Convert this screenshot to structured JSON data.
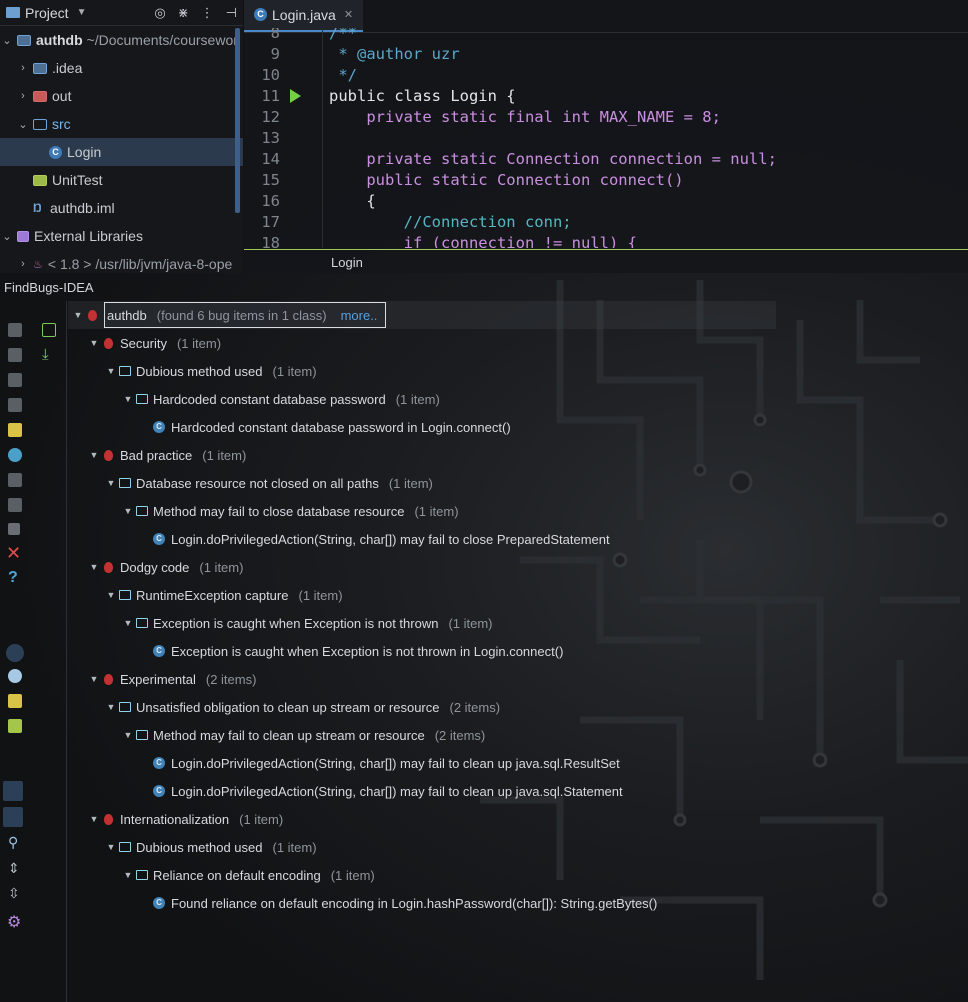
{
  "project": {
    "title": "Project",
    "header_icons": [
      "target-icon",
      "collapse-icon",
      "more-icon",
      "hide-icon"
    ],
    "tree": [
      {
        "label": "authdb",
        "extra": "~/Documents/coursewor",
        "level": 0,
        "icon": "folder"
      },
      {
        "label": ".idea",
        "level": 1,
        "icon": "folder"
      },
      {
        "label": "out",
        "level": 1,
        "icon": "folder-red"
      },
      {
        "label": "src",
        "level": 1,
        "icon": "folder-src"
      },
      {
        "label": "Login",
        "level": 2,
        "icon": "class"
      },
      {
        "label": "UnitTest",
        "level": 1,
        "icon": "folder-green"
      },
      {
        "label": "authdb.iml",
        "level": 1,
        "icon": "iml"
      },
      {
        "label": "External Libraries",
        "level": 0,
        "icon": "library"
      },
      {
        "label": "< 1.8 > /usr/lib/jvm/java-8-ope",
        "level": 1,
        "icon": "jdk"
      }
    ]
  },
  "editor": {
    "tab_label": "Login.java",
    "footer": "Login",
    "lines": [
      {
        "n": "8",
        "text": "/**"
      },
      {
        "n": "9",
        "text": " * @author uzr"
      },
      {
        "n": "10",
        "text": " */"
      },
      {
        "n": "11",
        "text": "public class Login {"
      },
      {
        "n": "12",
        "text": "    private static final int MAX_NAME = 8;"
      },
      {
        "n": "13",
        "text": ""
      },
      {
        "n": "14",
        "text": "    private static Connection connection = null;"
      },
      {
        "n": "15",
        "text": "    public static Connection connect()"
      },
      {
        "n": "16",
        "text": "    {"
      },
      {
        "n": "17",
        "text": "        //Connection conn;"
      },
      {
        "n": "18",
        "text": "        if (connection != null) {"
      }
    ]
  },
  "findbugs": {
    "title": "FindBugs-IDEA",
    "root": {
      "label": "authdb",
      "count": "(found 6 bug items in 1 class)",
      "more": "more.."
    },
    "rows": [
      {
        "level": 1,
        "type": "bug",
        "label": "Security",
        "count": "(1 item)"
      },
      {
        "level": 2,
        "type": "folder",
        "label": "Dubious method used",
        "count": "(1 item)"
      },
      {
        "level": 3,
        "type": "folder",
        "label": "Hardcoded constant database password",
        "count": "(1 item)"
      },
      {
        "level": 4,
        "type": "class",
        "label": "Hardcoded constant database password in Login.connect()",
        "count": ""
      },
      {
        "level": 1,
        "type": "bug",
        "label": "Bad practice",
        "count": "(1 item)"
      },
      {
        "level": 2,
        "type": "folder",
        "label": "Database resource not closed on all paths",
        "count": "(1 item)"
      },
      {
        "level": 3,
        "type": "folder",
        "label": "Method may fail to close database resource",
        "count": "(1 item)"
      },
      {
        "level": 4,
        "type": "class",
        "label": "Login.doPrivilegedAction(String, char[]) may fail to close PreparedStatement",
        "count": ""
      },
      {
        "level": 1,
        "type": "bug",
        "label": "Dodgy code",
        "count": "(1 item)"
      },
      {
        "level": 2,
        "type": "folder",
        "label": "RuntimeException capture",
        "count": "(1 item)"
      },
      {
        "level": 3,
        "type": "folder",
        "label": "Exception is caught when Exception is not thrown",
        "count": "(1 item)"
      },
      {
        "level": 4,
        "type": "class",
        "label": "Exception is caught when Exception is not thrown in Login.connect()",
        "count": ""
      },
      {
        "level": 1,
        "type": "bug",
        "label": "Experimental",
        "count": "(2 items)"
      },
      {
        "level": 2,
        "type": "folder",
        "label": "Unsatisfied obligation to clean up stream or resource",
        "count": "(2 items)"
      },
      {
        "level": 3,
        "type": "folder",
        "label": "Method may fail to clean up stream or resource",
        "count": "(2 items)"
      },
      {
        "level": 4,
        "type": "class",
        "label": "Login.doPrivilegedAction(String, char[]) may fail to clean up java.sql.ResultSet",
        "count": ""
      },
      {
        "level": 4,
        "type": "class",
        "label": "Login.doPrivilegedAction(String, char[]) may fail to clean up java.sql.Statement",
        "count": ""
      },
      {
        "level": 1,
        "type": "bug",
        "label": "Internationalization",
        "count": "(1 item)"
      },
      {
        "level": 2,
        "type": "folder",
        "label": "Dubious method used",
        "count": "(1 item)"
      },
      {
        "level": 3,
        "type": "folder",
        "label": "Reliance on default encoding",
        "count": "(1 item)"
      },
      {
        "level": 4,
        "type": "class",
        "label": "Found reliance on default encoding in Login.hashPassword(char[]): String.getBytes()",
        "count": ""
      }
    ]
  },
  "colors": {
    "accent": "#4a88c7",
    "bug": "#c13232",
    "folder": "#8fd4e6",
    "class_icon": "#3f83b8"
  }
}
